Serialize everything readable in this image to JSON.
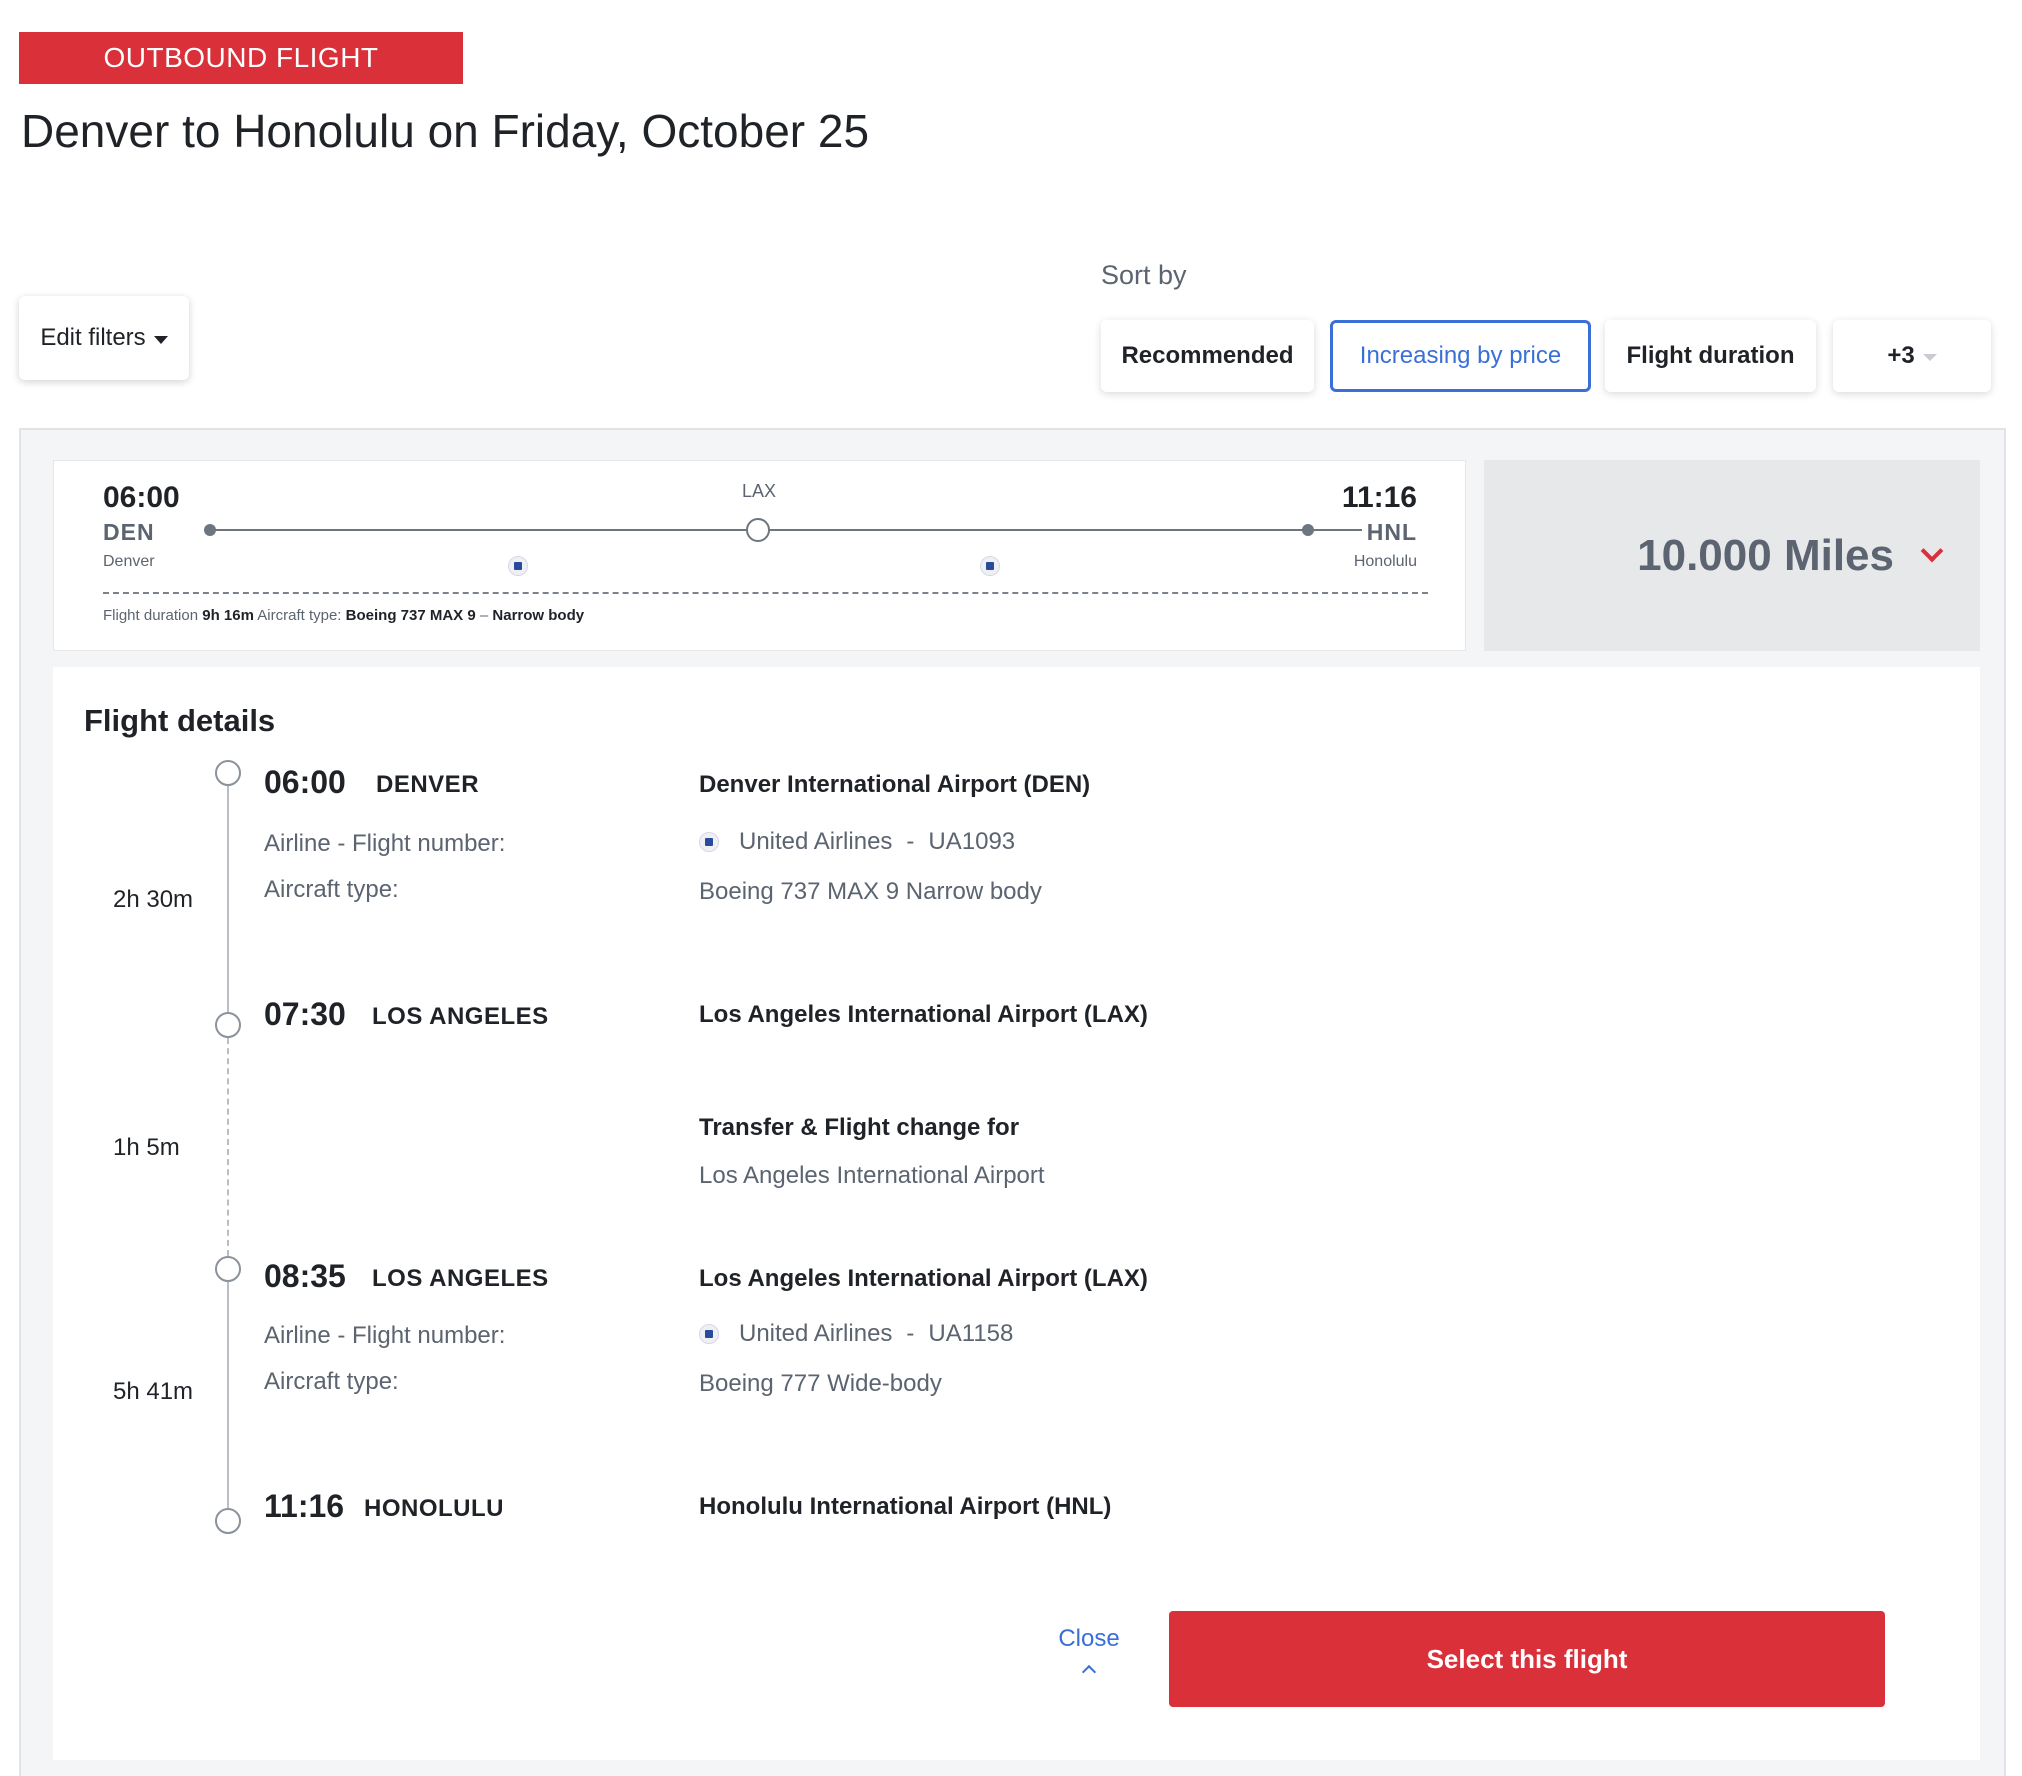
{
  "header": {
    "badge": "OUTBOUND FLIGHT",
    "title": "Denver to Honolulu on Friday, October 25"
  },
  "filters": {
    "edit_label": "Edit filters"
  },
  "sort": {
    "label": "Sort by",
    "options": [
      "Recommended",
      "Increasing by price",
      "Flight duration",
      "+3"
    ],
    "selected": "Increasing by price"
  },
  "summary": {
    "depart_time": "06:00",
    "depart_code": "DEN",
    "depart_city": "Denver",
    "stop_code": "LAX",
    "arrive_time": "11:16",
    "arrive_code": "HNL",
    "arrive_city": "Honolulu",
    "duration_label": "Flight duration",
    "duration_value": "9h 16m",
    "aircraft_label": "Aircraft type:",
    "aircraft_value": "Boeing 737 MAX 9",
    "separator": "–",
    "body_value": "Narrow body",
    "price": "10.000 Miles"
  },
  "details": {
    "title": "Flight details",
    "airline_label": "Airline - Flight number:",
    "aircraft_label": "Aircraft type:",
    "segments": [
      {
        "duration": "2h 30m",
        "dep_time": "06:00",
        "dep_city": "DENVER",
        "dep_airport": "Denver International Airport (DEN)",
        "airline": "United Airlines",
        "flight_no": "UA1093",
        "aircraft": "Boeing 737 MAX 9 Narrow body",
        "arr_time": "07:30",
        "arr_city": "LOS ANGELES",
        "arr_airport": "Los Angeles International Airport (LAX)"
      },
      {
        "duration": "5h 41m",
        "dep_time": "08:35",
        "dep_city": "LOS ANGELES",
        "dep_airport": "Los Angeles International Airport (LAX)",
        "airline": "United Airlines",
        "flight_no": "UA1158",
        "aircraft": "Boeing 777 Wide-body",
        "arr_time": "11:16",
        "arr_city": "HONOLULU",
        "arr_airport": "Honolulu International Airport (HNL)"
      }
    ],
    "transfer": {
      "duration": "1h 5m",
      "title": "Transfer & Flight change for",
      "airport": "Los Angeles International Airport"
    },
    "dash": "-"
  },
  "actions": {
    "close_label": "Close",
    "select_label": "Select this flight"
  },
  "colors": {
    "brand_red": "#d9303a",
    "accent_blue": "#3a6fd8"
  }
}
